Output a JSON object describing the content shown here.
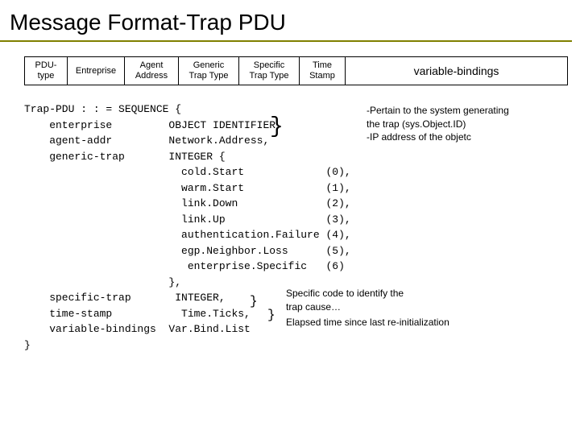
{
  "title": "Message Format-Trap PDU",
  "pdu": {
    "c1a": "PDU-",
    "c1b": "type",
    "c2": "Entreprise",
    "c3a": "Agent",
    "c3b": "Address",
    "c4a": "Generic",
    "c4b": "Trap Type",
    "c5a": "Specific",
    "c5b": "Trap Type",
    "c6a": "Time",
    "c6b": "Stamp",
    "c7": "variable-bindings"
  },
  "code": "Trap-PDU : : = SEQUENCE {\n    enterprise         OBJECT IDENTIFIER,\n    agent-addr         Network.Address,\n    generic-trap       INTEGER {\n                         cold.Start             (0),\n                         warm.Start             (1),\n                         link.Down              (2),\n                         link.Up                (3),\n                         authentication.Failure (4),\n                         egp.Neighbor.Loss      (5),\n                          enterprise.Specific   (6)\n                       },\n    specific-trap       INTEGER,\n    time-stamp           Time.Ticks,\n    variable-bindings  Var.Bind.List\n}",
  "anno1": "-Pertain to the system generating\nthe trap (sys.Object.ID)\n-IP address of the objetc",
  "anno2": "Specific code to identify the\ntrap cause…",
  "anno3": "Elapsed time since last re-initialization"
}
